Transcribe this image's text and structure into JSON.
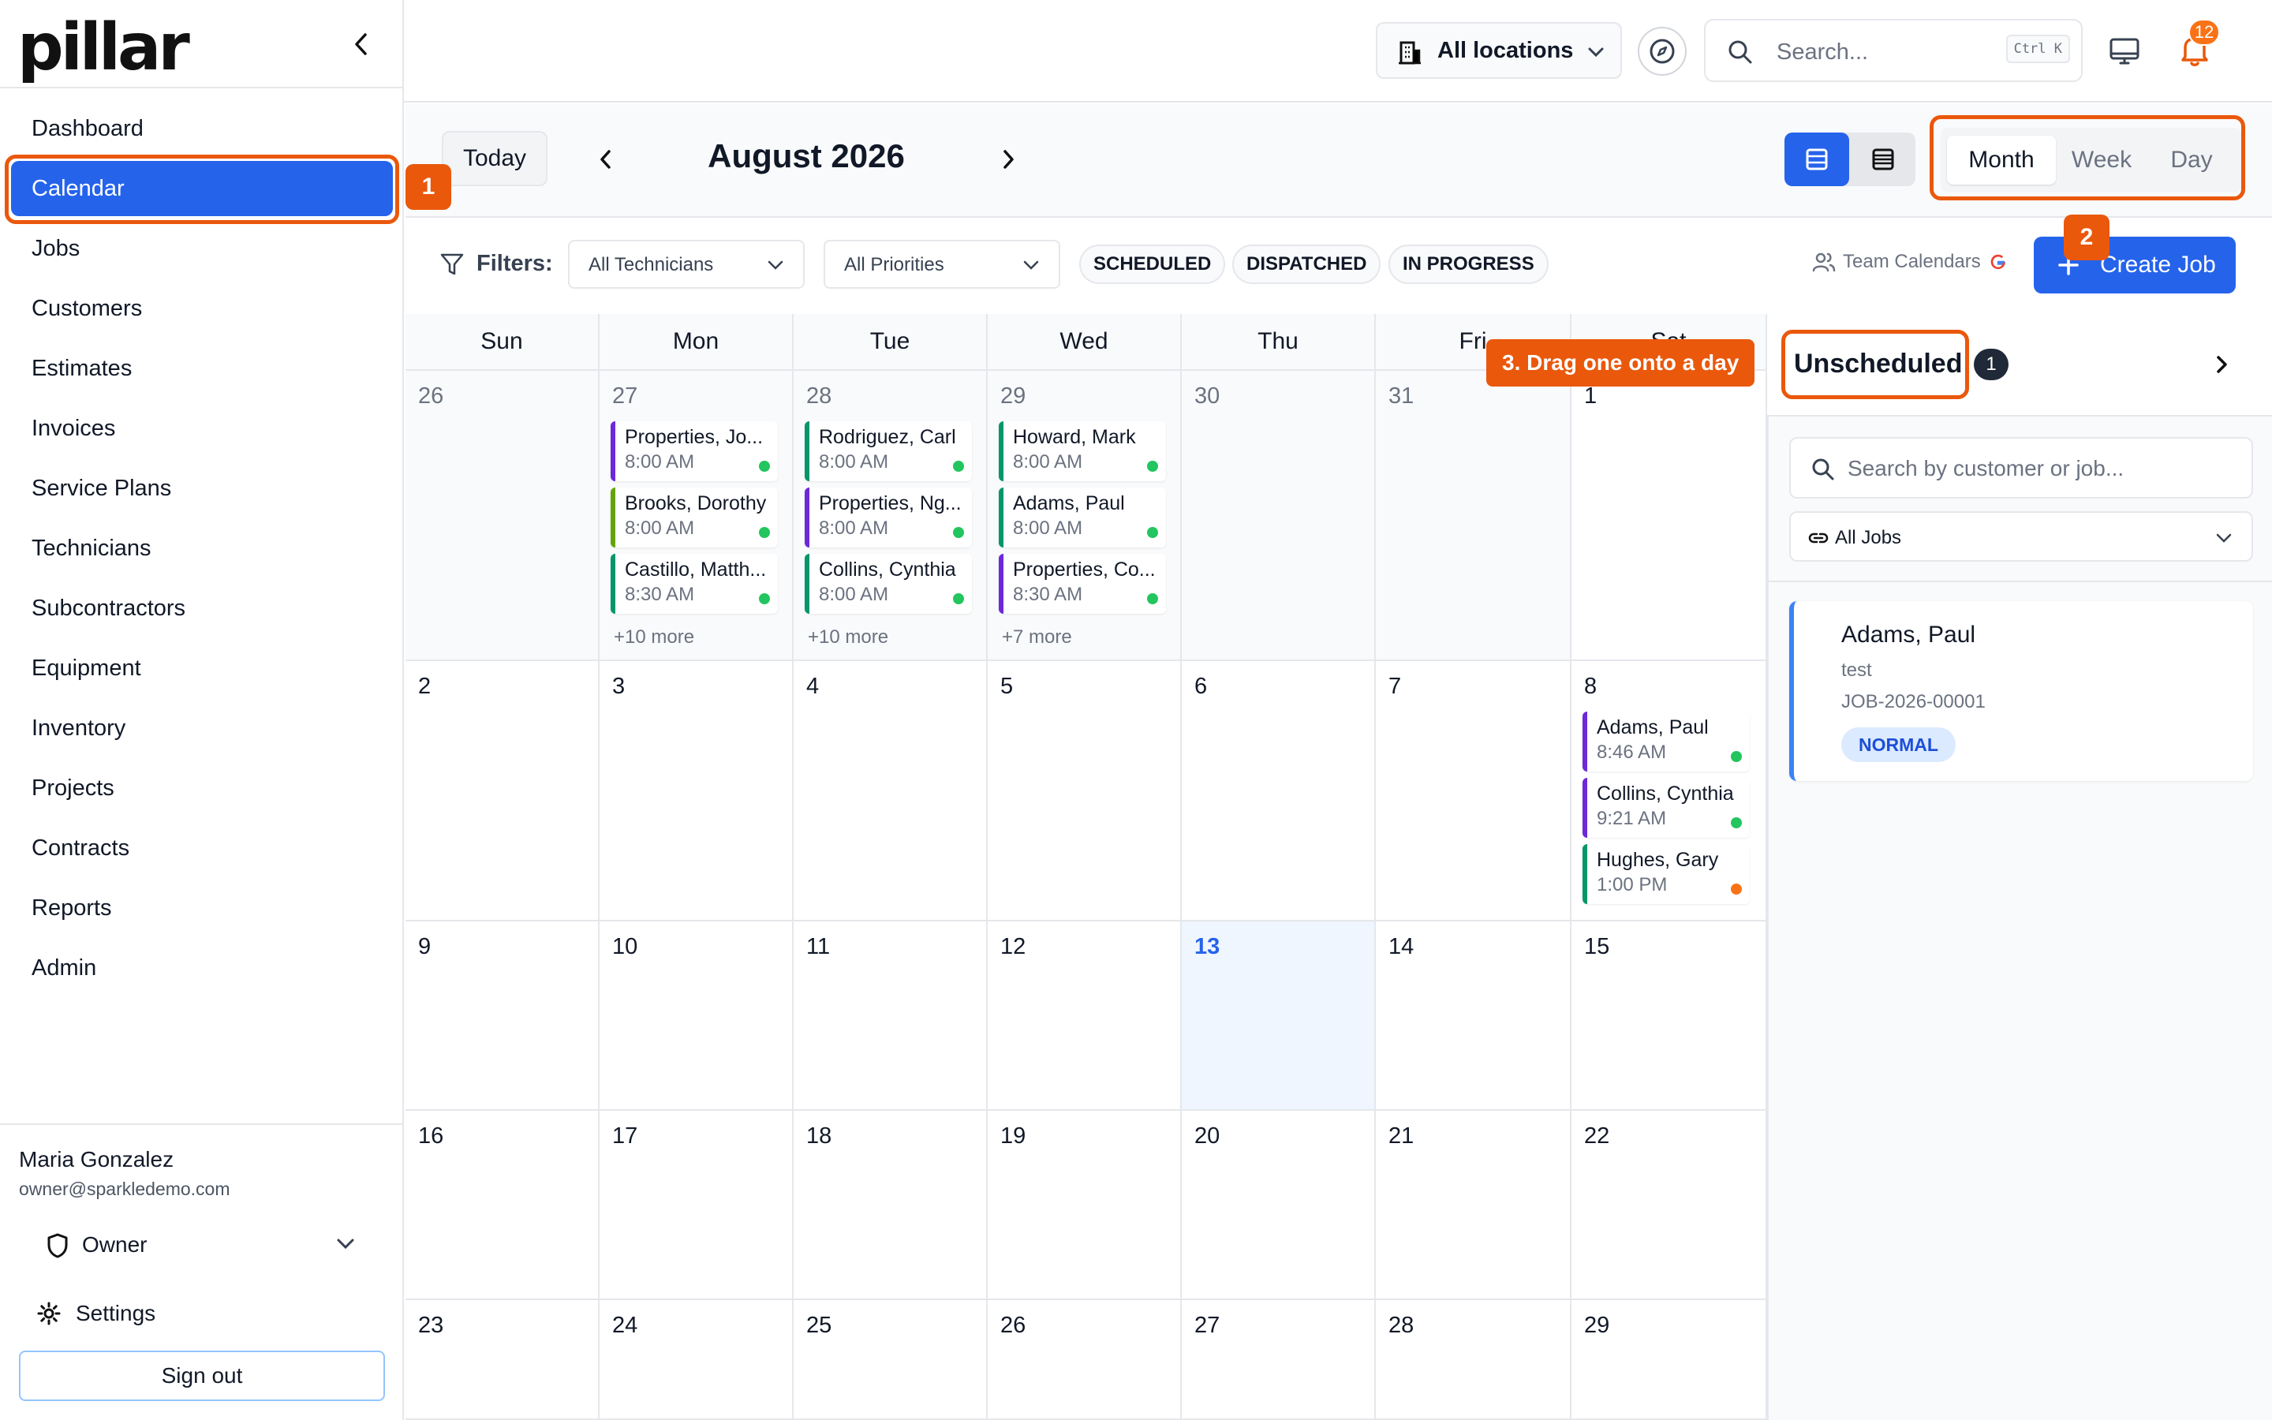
{
  "brand": {
    "logo_text": "pillar"
  },
  "sidebar": {
    "items": [
      {
        "label": "Dashboard"
      },
      {
        "label": "Calendar",
        "active": true
      },
      {
        "label": "Jobs"
      },
      {
        "label": "Customers"
      },
      {
        "label": "Estimates"
      },
      {
        "label": "Invoices"
      },
      {
        "label": "Service Plans"
      },
      {
        "label": "Technicians"
      },
      {
        "label": "Subcontractors"
      },
      {
        "label": "Equipment"
      },
      {
        "label": "Inventory"
      },
      {
        "label": "Projects"
      },
      {
        "label": "Contracts"
      },
      {
        "label": "Reports"
      },
      {
        "label": "Admin"
      }
    ],
    "user": {
      "name": "Maria Gonzalez",
      "email": "owner@sparkledemo.com",
      "role": "Owner"
    },
    "settings_label": "Settings",
    "signout_label": "Sign out"
  },
  "topbar": {
    "locations_label": "All locations",
    "search_placeholder": "Search...",
    "search_shortcut": "Ctrl K",
    "notification_count": "12"
  },
  "toolbar": {
    "today_label": "Today",
    "month_title": "August 2026",
    "period_options": [
      "Month",
      "Week",
      "Day"
    ],
    "active_period": "Month",
    "filters_label": "Filters:",
    "technician_filter": "All Technicians",
    "priority_filter": "All Priorities",
    "status_pills": [
      "SCHEDULED",
      "DISPATCHED",
      "IN PROGRESS"
    ],
    "team_calendars_label": "Team Calendars",
    "create_job_label": "Create Job"
  },
  "calendar": {
    "weekdays": [
      "Sun",
      "Mon",
      "Tue",
      "Wed",
      "Thu",
      "Fri",
      "Sat"
    ],
    "weeks": [
      [
        {
          "day": "26",
          "other": true
        },
        {
          "day": "27",
          "other": true,
          "events": [
            {
              "name": "Properties, Jo...",
              "time": "8:00 AM",
              "color": "#6d28d9",
              "status": "#22c55e"
            },
            {
              "name": "Brooks, Dorothy",
              "time": "8:00 AM",
              "color": "#65a30d",
              "status": "#22c55e"
            },
            {
              "name": "Castillo, Matth...",
              "time": "8:30 AM",
              "color": "#059669",
              "status": "#22c55e"
            }
          ],
          "more": "+10 more"
        },
        {
          "day": "28",
          "other": true,
          "events": [
            {
              "name": "Rodriguez, Carl",
              "time": "8:00 AM",
              "color": "#059669",
              "status": "#22c55e"
            },
            {
              "name": "Properties, Ng...",
              "time": "8:00 AM",
              "color": "#6d28d9",
              "status": "#22c55e"
            },
            {
              "name": "Collins, Cynthia",
              "time": "8:00 AM",
              "color": "#059669",
              "status": "#22c55e"
            }
          ],
          "more": "+10 more"
        },
        {
          "day": "29",
          "other": true,
          "events": [
            {
              "name": "Howard, Mark",
              "time": "8:00 AM",
              "color": "#059669",
              "status": "#22c55e"
            },
            {
              "name": "Adams, Paul",
              "time": "8:00 AM",
              "color": "#059669",
              "status": "#22c55e"
            },
            {
              "name": "Properties, Co...",
              "time": "8:30 AM",
              "color": "#6d28d9",
              "status": "#22c55e"
            }
          ],
          "more": "+7 more"
        },
        {
          "day": "30",
          "other": true
        },
        {
          "day": "31",
          "other": true
        },
        {
          "day": "1"
        }
      ],
      [
        {
          "day": "2"
        },
        {
          "day": "3"
        },
        {
          "day": "4"
        },
        {
          "day": "5"
        },
        {
          "day": "6"
        },
        {
          "day": "7"
        },
        {
          "day": "8",
          "events": [
            {
              "name": "Adams, Paul",
              "time": "8:46 AM",
              "color": "#6d28d9",
              "status": "#22c55e"
            },
            {
              "name": "Collins, Cynthia",
              "time": "9:21 AM",
              "color": "#6d28d9",
              "status": "#22c55e"
            },
            {
              "name": "Hughes, Gary",
              "time": "1:00 PM",
              "color": "#059669",
              "status": "#f97316"
            }
          ]
        }
      ],
      [
        {
          "day": "9"
        },
        {
          "day": "10"
        },
        {
          "day": "11"
        },
        {
          "day": "12"
        },
        {
          "day": "13",
          "today": true
        },
        {
          "day": "14"
        },
        {
          "day": "15"
        }
      ],
      [
        {
          "day": "16"
        },
        {
          "day": "17"
        },
        {
          "day": "18"
        },
        {
          "day": "19"
        },
        {
          "day": "20"
        },
        {
          "day": "21"
        },
        {
          "day": "22"
        }
      ],
      [
        {
          "day": "23"
        },
        {
          "day": "24"
        },
        {
          "day": "25"
        },
        {
          "day": "26"
        },
        {
          "day": "27"
        },
        {
          "day": "28"
        },
        {
          "day": "29"
        }
      ]
    ]
  },
  "unscheduled": {
    "title": "Unscheduled",
    "count": "1",
    "search_placeholder": "Search by customer or job...",
    "filter_label": "All Jobs",
    "jobs": [
      {
        "name": "Adams, Paul",
        "description": "test",
        "number": "JOB-2026-00001",
        "priority": "NORMAL"
      }
    ]
  },
  "tutorial": {
    "step1": "1",
    "step2": "2",
    "step3_tip": "3. Drag one onto a day"
  },
  "colors": {
    "primary": "#2563eb",
    "highlight": "#ea580c",
    "today_bg": "#eff6ff"
  }
}
